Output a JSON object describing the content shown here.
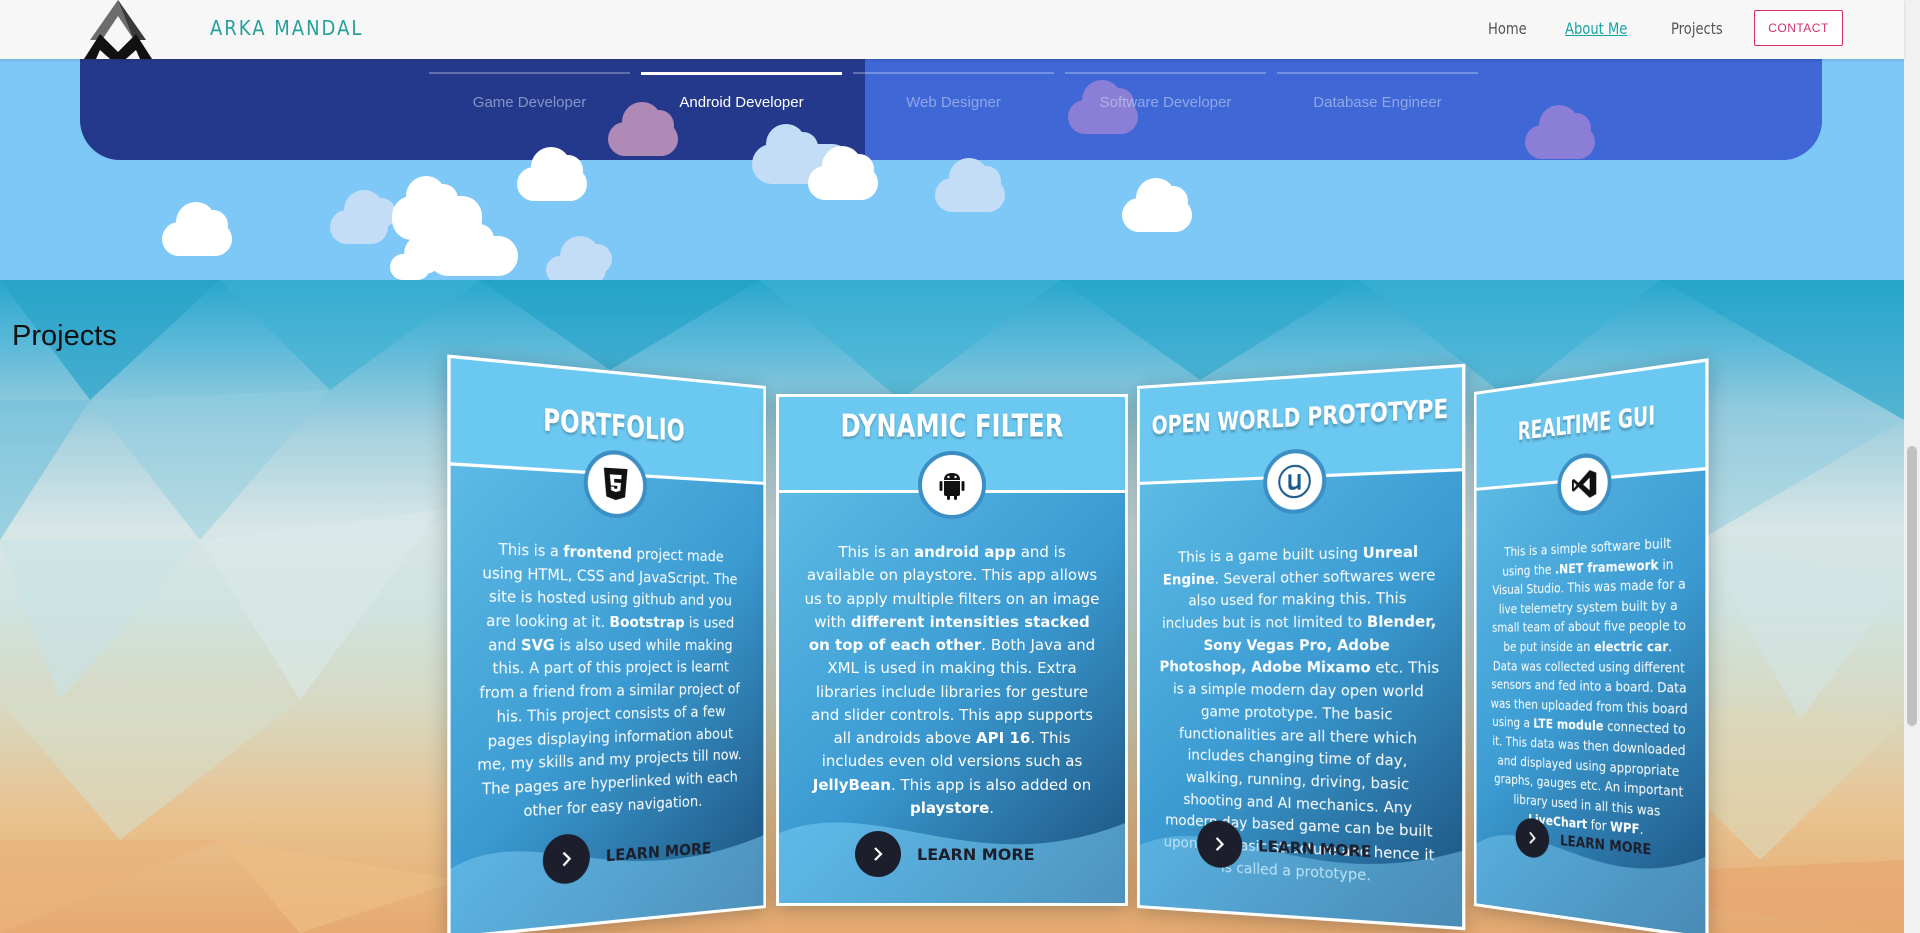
{
  "navbar": {
    "brand": "ARKA MANDAL",
    "links": [
      "Home",
      "About Me",
      "Projects"
    ],
    "active_link": "About Me",
    "contact": "CONTACT"
  },
  "skills": {
    "tabs": [
      "Game Developer",
      "Android Developer",
      "Web Designer",
      "Software Developer",
      "Database Engineer"
    ],
    "active": "Android Developer"
  },
  "projects": {
    "title": "Projects",
    "cards": [
      {
        "title": "PORTFOLIO",
        "icon": "html5-icon",
        "description_html": "This is a <b>frontend</b> project made using HTML, CSS and JavaScript. The site is hosted using github and you are looking at it. <b>Bootstrap</b> is used and <b>SVG</b> is also used while making this. A part of this project is learnt from a friend from a similar project of his. This project consists of a few pages displaying information about me, my skills and my projects till now. The pages are hyperlinked with each other for easy navigation.",
        "cta": "LEARN MORE"
      },
      {
        "title": "DYNAMIC FILTER",
        "icon": "android-icon",
        "description_html": "This is an <b>android app</b> and is available on playstore. This app allows us to apply multiple filters on an image with <b>different intensities stacked on top of each other</b>. Both Java and XML is used in making this. Extra libraries include libraries for gesture and slider controls. This app supports all androids above <b>API 16</b>. This includes even old versions such as <b>JellyBean</b>. This app is also added on <b>playstore</b>.",
        "cta": "LEARN MORE"
      },
      {
        "title": "OPEN WORLD PROTOTYPE",
        "icon": "unreal-engine-icon",
        "description_html": "This is a game built using <b>Unreal Engine</b>. Several other softwares were also used for making this. This includes but is not limited to <b>Blender, Sony Vegas Pro, Adobe Photoshop, Adobe Mixamo</b> etc. This is a simple modern day open world game prototype. The basic functionalities are all there which includes changing time of day, walking, running, driving, basic shooting and AI mechanics. Any modern day based game can be built upon this basic structure and hence it is called a prototype.",
        "cta": "LEARN MORE"
      },
      {
        "title": "REALTIME GUI",
        "icon": "visual-studio-icon",
        "description_html": "This is a simple software built using the <b>.NET framework</b> in Visual Studio. This was made for a live telemetry system built by a small team of about five people to be put inside an <b>electric car</b>. Data was collected using different sensors and fed into a board. Data was then uploaded from this board using a <b>LTE module</b> connected to it. This data was then downloaded and displayed using appropriate graphs, gauges etc. An important library used in all this was <b>LiveChart</b> for <b>WPF</b>.",
        "cta": "LEARN MORE"
      }
    ]
  },
  "colors": {
    "brand": "#27a09a",
    "contact": "#d2316e",
    "sky": "#7ec8f8",
    "panel_dark": "#25398c",
    "panel_light": "#3f67d6",
    "card_head": "#6bc8f0"
  }
}
